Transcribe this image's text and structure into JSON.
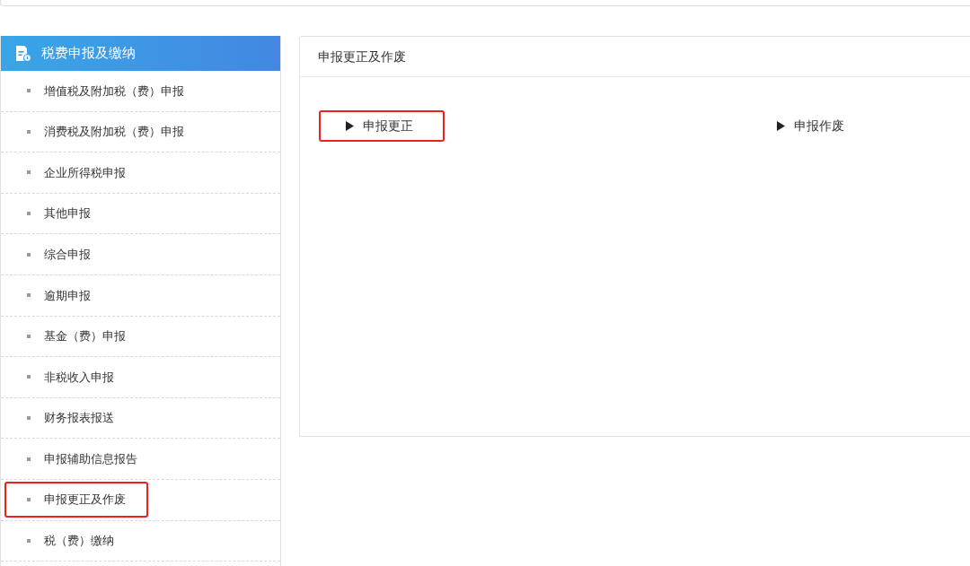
{
  "sidebar": {
    "title": "税费申报及缴纳",
    "items": [
      {
        "label": "增值税及附加税（费）申报",
        "highlighted": false
      },
      {
        "label": "消费税及附加税（费）申报",
        "highlighted": false
      },
      {
        "label": "企业所得税申报",
        "highlighted": false
      },
      {
        "label": "其他申报",
        "highlighted": false
      },
      {
        "label": "综合申报",
        "highlighted": false
      },
      {
        "label": "逾期申报",
        "highlighted": false
      },
      {
        "label": "基金（费）申报",
        "highlighted": false
      },
      {
        "label": "非税收入申报",
        "highlighted": false
      },
      {
        "label": "财务报表报送",
        "highlighted": false
      },
      {
        "label": "申报辅助信息报告",
        "highlighted": false
      },
      {
        "label": "申报更正及作废",
        "highlighted": true
      },
      {
        "label": "税（费）缴纳",
        "highlighted": false
      }
    ]
  },
  "panel": {
    "title": "申报更正及作废",
    "actions": [
      {
        "label": "申报更正",
        "highlighted": true
      },
      {
        "label": "申报作废",
        "highlighted": false
      }
    ]
  }
}
